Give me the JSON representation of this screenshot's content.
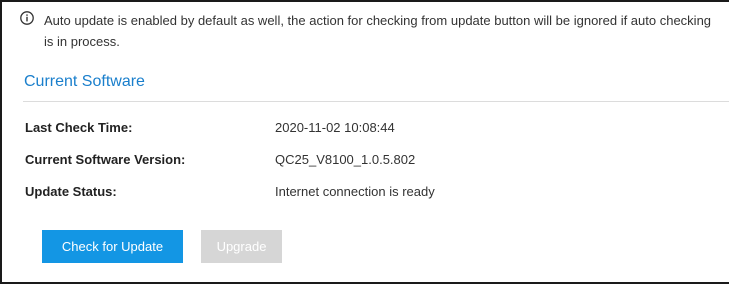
{
  "notice": {
    "icon": "info-icon",
    "text": "Auto update is enabled by default as well, the action for checking from update button will be ignored if auto checking is in process."
  },
  "section": {
    "title": "Current Software"
  },
  "details": {
    "last_check_label": "Last Check Time:",
    "last_check_value": "2020-11-02 10:08:44",
    "version_label": "Current Software Version:",
    "version_value": "QC25_V8100_1.0.5.802",
    "status_label": "Update Status:",
    "status_value": "Internet connection is ready"
  },
  "actions": {
    "check_label": "Check for Update",
    "upgrade_label": "Upgrade"
  },
  "colors": {
    "accent": "#1396e4",
    "title": "#1a7fcc",
    "disabled": "#d6d6d6"
  }
}
